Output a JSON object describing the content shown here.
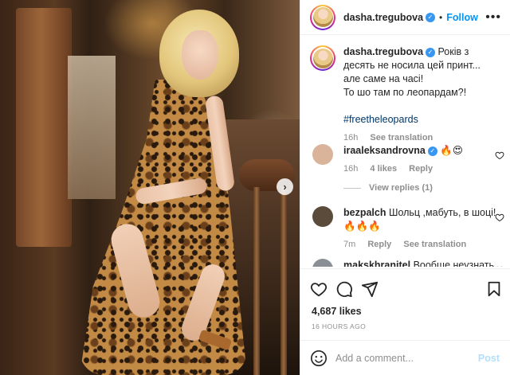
{
  "post": {
    "author": "dasha.tregubova",
    "follow_label": "Follow",
    "separator": "•",
    "more_label": "•••"
  },
  "caption": {
    "username": "dasha.tregubova",
    "text": "Років з десять не носила цей принт... але саме на часі!",
    "line2": "То шо там по леопардам?!",
    "hashtag": "#freetheleopards",
    "time": "16h",
    "see_translation": "See translation"
  },
  "comments": [
    {
      "username": "iraaleksandrovna",
      "text": "🔥😍",
      "time": "16h",
      "likes": "4 likes",
      "reply": "Reply",
      "avatar_color": "#d9b39a"
    },
    {
      "username": "bezpalch",
      "text": "Шольц ,мабуть, в шоці! 🔥🔥🔥",
      "time": "7m",
      "reply": "Reply",
      "see_translation": "See translation",
      "avatar_color": "#5b4b3a"
    },
    {
      "username": "makskhranitel",
      "text": "Вообще неузнать.",
      "avatar_color": "#8a8f96"
    }
  ],
  "view_replies": "View replies (1)",
  "likes_count": "4,687 likes",
  "time_ago": "16 HOURS AGO",
  "add_comment": {
    "placeholder": "Add a comment...",
    "post_label": "Post"
  },
  "carousel": {
    "next_label": "›"
  },
  "colors": {
    "accent": "#0095f6",
    "muted": "#8e8e8e",
    "verified": "#3897f0",
    "hashtag": "#00376b"
  },
  "icons": [
    "verified-icon",
    "heart-icon",
    "comment-icon",
    "share-icon",
    "bookmark-icon",
    "emoji-icon",
    "more-icon",
    "chevron-right-icon"
  ]
}
